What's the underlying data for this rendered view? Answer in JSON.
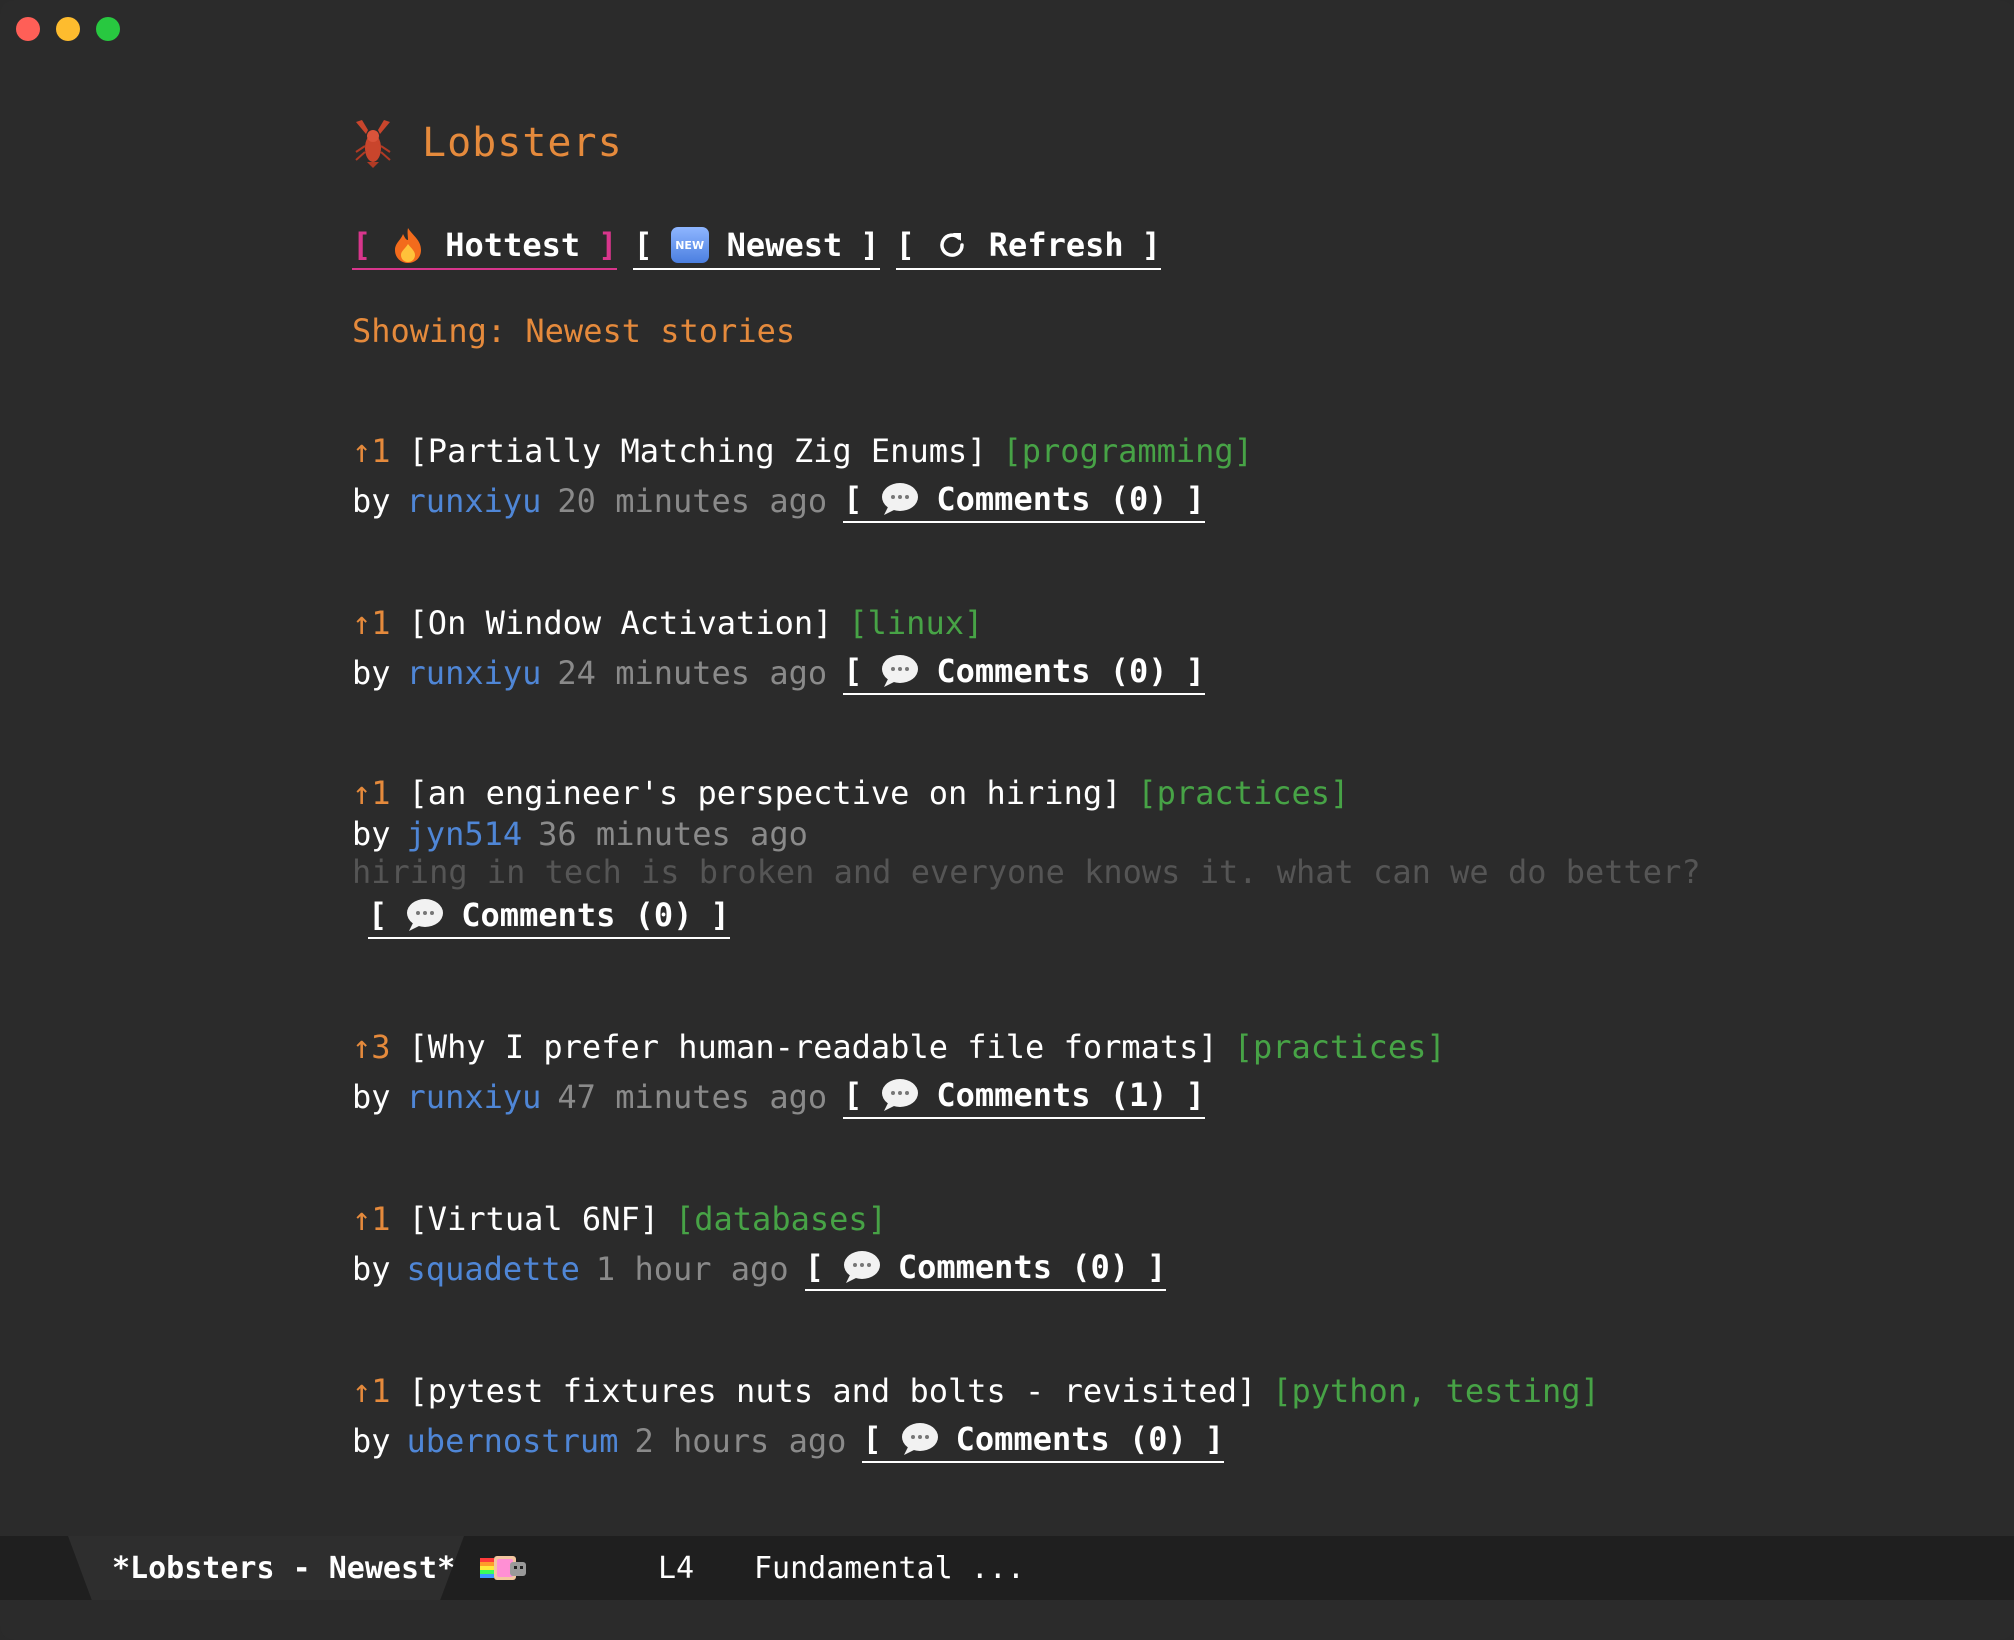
{
  "header": {
    "logo_icon": "lobster-icon",
    "title": "Lobsters"
  },
  "nav": {
    "hottest": {
      "open": "[",
      "icon": "fire-icon",
      "label": "Hottest",
      "close": "]"
    },
    "newest": {
      "open": "[",
      "icon": "new-badge-icon",
      "badge": "NEW",
      "label": "Newest",
      "close": "]"
    },
    "refresh": {
      "open": "[",
      "icon": "refresh-icon",
      "label": "Refresh",
      "close": "]"
    }
  },
  "status": {
    "showing": "Showing: Newest stories"
  },
  "stories": [
    {
      "arrow": "↑",
      "score": "1",
      "title": "[Partially Matching Zig Enums]",
      "tags": "[programming]",
      "by": "by",
      "author": "runxiyu",
      "age": "20 minutes ago",
      "description": "",
      "comments": {
        "open": "[",
        "label": "Comments (0)",
        "close": "]"
      }
    },
    {
      "arrow": "↑",
      "score": "1",
      "title": "[On Window Activation]",
      "tags": "[linux]",
      "by": "by",
      "author": "runxiyu",
      "age": "24 minutes ago",
      "description": "",
      "comments": {
        "open": "[",
        "label": "Comments (0)",
        "close": "]"
      }
    },
    {
      "arrow": "↑",
      "score": "1",
      "title": "[an engineer's perspective on hiring]",
      "tags": "[practices]",
      "by": "by",
      "author": "jyn514",
      "age": "36 minutes ago",
      "description": "hiring in tech is broken and everyone knows it. what can we do better?",
      "comments": {
        "open": "[",
        "label": "Comments (0)",
        "close": "]"
      }
    },
    {
      "arrow": "↑",
      "score": "3",
      "title": "[Why I prefer human-readable file formats]",
      "tags": "[practices]",
      "by": "by",
      "author": "runxiyu",
      "age": "47 minutes ago",
      "description": "",
      "comments": {
        "open": "[",
        "label": "Comments (1)",
        "close": "]"
      }
    },
    {
      "arrow": "↑",
      "score": "1",
      "title": "[Virtual 6NF]",
      "tags": "[databases]",
      "by": "by",
      "author": "squadette",
      "age": "1 hour ago",
      "description": "",
      "comments": {
        "open": "[",
        "label": "Comments (0)",
        "close": "]"
      }
    },
    {
      "arrow": "↑",
      "score": "1",
      "title": "[pytest fixtures nuts and bolts - revisited]",
      "tags": "[python, testing]",
      "by": "by",
      "author": "ubernostrum",
      "age": "2 hours ago",
      "description": "",
      "comments": {
        "open": "[",
        "label": "Comments (0)",
        "close": "]"
      }
    }
  ],
  "modeline": {
    "buffer_name": "*Lobsters - Newest*",
    "nyan_icon": "nyan-cat-icon",
    "line": "L4",
    "mode": "Fundamental ..."
  },
  "colors": {
    "background": "#2b2b2b",
    "accent_orange": "#e58a3c",
    "accent_pink": "#d8368c",
    "tag_green": "#47a346",
    "author_blue": "#4f86d6",
    "muted_gray": "#8a8a8a"
  }
}
